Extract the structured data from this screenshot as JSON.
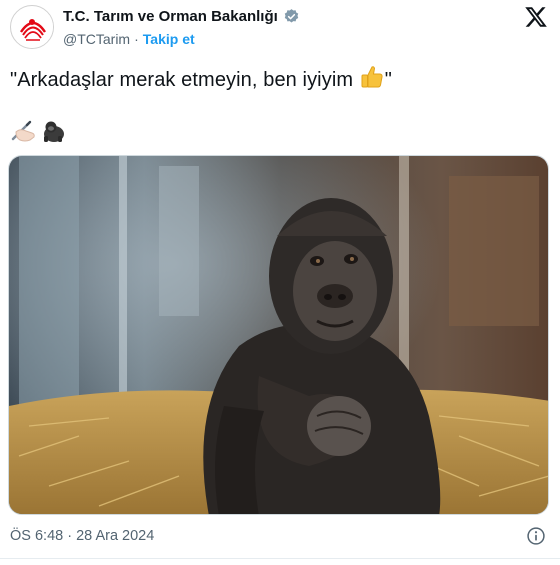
{
  "account": {
    "display_name": "T.C. Tarım ve Orman Bakanlığı",
    "handle": "@TCTarim",
    "separator": "·",
    "follow_label": "Takip et",
    "verified_color": "#829aab"
  },
  "tweet": {
    "text": "\"Arkadaşlar merak etmeyin, ben iyiyim ",
    "text_emoji": "thumbs-up",
    "text_close_quote": "\"",
    "emoji_line": [
      "writing-hand",
      "gorilla"
    ]
  },
  "media": {
    "subject": "gorilla-photo"
  },
  "footer": {
    "timestamp": "ÖS 6:48 · 28 Ara 2024"
  },
  "colors": {
    "link": "#1d9bf0",
    "secondary_text": "#536471",
    "primary_text": "#0f1419"
  }
}
